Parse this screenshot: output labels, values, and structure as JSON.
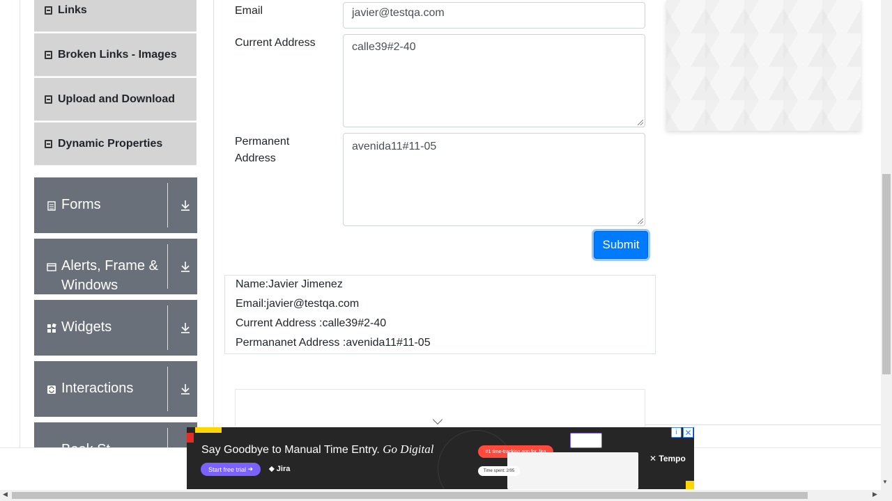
{
  "sidebar": {
    "sub_items": [
      {
        "label": "Links",
        "icon": "document-icon"
      },
      {
        "label": "Broken Links - Images",
        "icon": "document-icon"
      },
      {
        "label": "Upload and Download",
        "icon": "document-icon"
      },
      {
        "label": "Dynamic Properties",
        "icon": "document-icon"
      }
    ],
    "groups": [
      {
        "label": "Forms",
        "icon": "form-icon"
      },
      {
        "label": "Alerts, Frame &",
        "label2": "Windows",
        "icon": "window-icon"
      },
      {
        "label": "Widgets",
        "icon": "widgets-icon"
      },
      {
        "label": "Interactions",
        "icon": "interactions-icon"
      },
      {
        "label": "Book St",
        "icon": "book-icon"
      }
    ]
  },
  "form": {
    "email_label": "Email",
    "email_value": "javier@testqa.com",
    "current_address_label": "Current Address",
    "current_address_value": "calle39#2-40",
    "permanent_address_label_line1": "Permanent",
    "permanent_address_label_line2": "Address",
    "permanent_address_value": "avenida11#11-05",
    "submit_label": "Submit"
  },
  "output": {
    "name": "Name:Javier Jimenez",
    "email": "Email:javier@testqa.com",
    "current_address": "Current Address :calle39#2-40",
    "permanent_address": "Permananet Address :avenida11#11-05"
  },
  "ad": {
    "headline": "Say Goodbye to Manual Time Entry.",
    "headline_italic": "Go Digital",
    "cta": "Start free trial",
    "partner": "Jira",
    "badge": "#1 time-tracking app for Jira",
    "time_chip": "Time spent: 2/95",
    "brand": "Tempo",
    "info_icon": "info-icon",
    "close_icon": "close-icon"
  },
  "colors": {
    "sidebar_group_bg": "#69707a",
    "sidebar_item_bg": "#d4d4d4",
    "submit_bg": "#007bff",
    "ad_bg": "#262626"
  }
}
